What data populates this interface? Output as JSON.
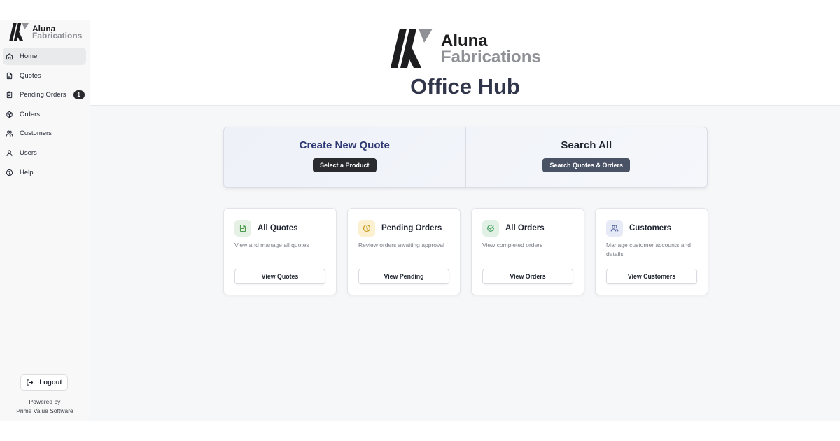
{
  "brand": {
    "name_line1": "Aluna",
    "name_line2": "Fabrications",
    "logo_icon": "aluna-logo-icon",
    "colors": {
      "dark": "#1d1d1f",
      "grey": "#8f9196"
    }
  },
  "sidebar": {
    "items": [
      {
        "label": "Home",
        "icon": "home-icon",
        "active": true
      },
      {
        "label": "Quotes",
        "icon": "document-icon"
      },
      {
        "label": "Pending Orders",
        "icon": "clipboard-icon",
        "badge": "1"
      },
      {
        "label": "Orders",
        "icon": "package-icon"
      },
      {
        "label": "Customers",
        "icon": "users-icon"
      },
      {
        "label": "Users",
        "icon": "user-icon"
      },
      {
        "label": "Help",
        "icon": "help-circle-icon"
      }
    ],
    "logout_label": "Logout",
    "powered_by": "Powered by",
    "powered_link": "Prime Value Software"
  },
  "hero": {
    "title": "Office Hub"
  },
  "actions": {
    "create": {
      "title": "Create New Quote",
      "button": "Select a Product"
    },
    "search": {
      "title": "Search All",
      "button": "Search Quotes & Orders"
    }
  },
  "cards": [
    {
      "title": "All Quotes",
      "desc": "View and manage all quotes",
      "button": "View Quotes",
      "icon": "document-icon",
      "icon_bg": "#e4f1e4",
      "icon_color": "#4a9a4a"
    },
    {
      "title": "Pending Orders",
      "desc": "Review orders awaiting approval",
      "button": "View Pending",
      "icon": "clock-icon",
      "icon_bg": "#fbf0cf",
      "icon_color": "#c59314"
    },
    {
      "title": "All Orders",
      "desc": "View completed orders",
      "button": "View Orders",
      "icon": "check-circle-icon",
      "icon_bg": "#e2f1e6",
      "icon_color": "#3d9a5a"
    },
    {
      "title": "Customers",
      "desc": "Manage customer accounts and details",
      "button": "View Customers",
      "icon": "users-icon",
      "icon_bg": "#e5eaf6",
      "icon_color": "#4a5d9a"
    }
  ]
}
